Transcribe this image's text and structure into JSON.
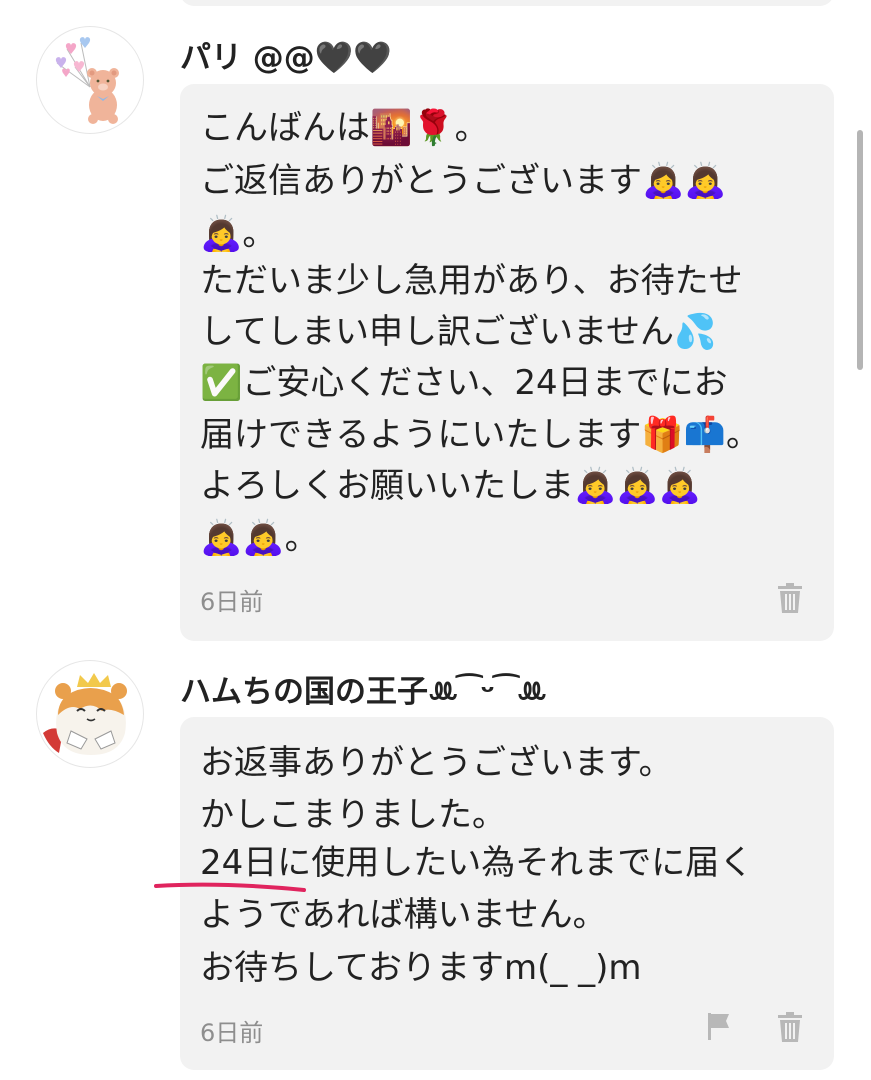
{
  "comments": [
    {
      "username": "パリ @@🖤🖤",
      "lines": [
        "こんばんは🌇🌹。",
        "ご返信ありがとうございます🙇‍♀️🙇‍♀️",
        "🙇‍♀️。",
        "ただいま少し急用があり、お待たせ",
        "してしまい申し訳ございません💦",
        "✅ご安心ください、24日までにお",
        "届けできるようにいたします🎁📫。",
        "よろしくお願いいたしま🙇‍♀️🙇‍♀️🙇‍♀️",
        "🙇‍♀️🙇‍♀️。"
      ],
      "time": "6日前",
      "avatar_icon": "teddy-bear-with-balloons",
      "action_icons": [
        "trash-icon"
      ]
    },
    {
      "username": "ハムちの国の王子ꔛ ͡ ᵕ ͡ ꔛ",
      "lines": [
        "お返事ありがとうございます。",
        "かしこまりました。",
        "24日に使用したい為それまでに届く",
        "ようであれば構いません。",
        "お待ちしておりますm(_ _)m"
      ],
      "time": "6日前",
      "avatar_icon": "hamster-prince",
      "action_icons": [
        "flag-icon",
        "trash-icon"
      ]
    }
  ],
  "colors": {
    "bubble": "#f2f2f2",
    "time_text": "#8e8e8e",
    "icon_gray": "#b8b8b8",
    "underline": "#e0245e"
  }
}
